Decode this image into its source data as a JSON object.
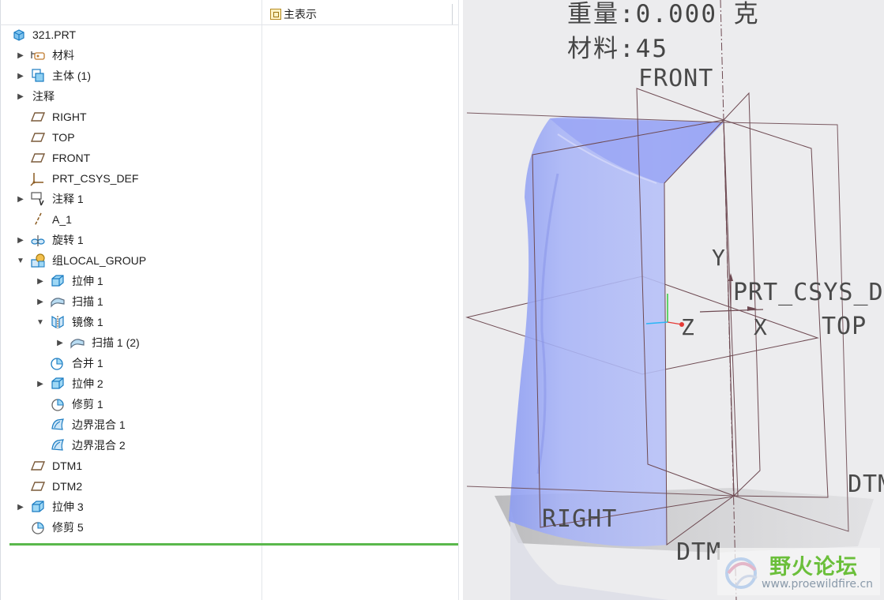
{
  "tree": {
    "column_header": "主表示",
    "root": "321.PRT",
    "items": [
      {
        "label": "材料",
        "icon": "material-icon",
        "expander": "collapsed"
      },
      {
        "label": "主体 (1)",
        "icon": "body-icon",
        "expander": "collapsed"
      },
      {
        "label": "注释",
        "icon": "",
        "expander": "collapsed"
      },
      {
        "label": "RIGHT",
        "icon": "datum-plane-icon",
        "expander": "none"
      },
      {
        "label": "TOP",
        "icon": "datum-plane-icon",
        "expander": "none"
      },
      {
        "label": "FRONT",
        "icon": "datum-plane-icon",
        "expander": "none"
      },
      {
        "label": "PRT_CSYS_DEF",
        "icon": "csys-icon",
        "expander": "none"
      },
      {
        "label": "注释 1",
        "icon": "annotation-icon",
        "expander": "collapsed"
      },
      {
        "label": "A_1",
        "icon": "datum-axis-icon",
        "expander": "none"
      },
      {
        "label": "旋转 1",
        "icon": "revolve-icon",
        "expander": "collapsed"
      },
      {
        "label": "组LOCAL_GROUP",
        "icon": "group-icon",
        "expander": "expanded"
      },
      {
        "label": "拉伸 1",
        "icon": "extrude-icon",
        "expander": "collapsed"
      },
      {
        "label": "扫描 1",
        "icon": "sweep-icon",
        "expander": "collapsed"
      },
      {
        "label": "镜像 1",
        "icon": "mirror-icon",
        "expander": "expanded"
      },
      {
        "label": "扫描 1 (2)",
        "icon": "sweep-icon",
        "expander": "collapsed"
      },
      {
        "label": "合并 1",
        "icon": "merge-icon",
        "expander": "none"
      },
      {
        "label": "拉伸 2",
        "icon": "extrude-icon",
        "expander": "collapsed"
      },
      {
        "label": "修剪 1",
        "icon": "trim-icon",
        "expander": "none"
      },
      {
        "label": "边界混合 1",
        "icon": "boundary-blend-icon",
        "expander": "none"
      },
      {
        "label": "边界混合 2",
        "icon": "boundary-blend-icon",
        "expander": "none"
      },
      {
        "label": "DTM1",
        "icon": "datum-plane-icon",
        "expander": "none"
      },
      {
        "label": "DTM2",
        "icon": "datum-plane-icon",
        "expander": "none"
      },
      {
        "label": "拉伸 3",
        "icon": "extrude-icon",
        "expander": "collapsed"
      },
      {
        "label": "修剪 5",
        "icon": "trim-icon",
        "expander": "none"
      }
    ]
  },
  "viewport": {
    "note_weight": "重量:0.000 克",
    "note_material": "材料:45",
    "datum_front": "FRONT",
    "datum_top": "TOP",
    "datum_right": "RIGHT",
    "datum_dtm_bottom": "DTM",
    "datum_dtm_right": "DTM",
    "csys_label": "PRT_CSYS_D",
    "axis_y": "Y",
    "axis_x": "X",
    "axis_z": "Z",
    "watermark_title": "野火论坛",
    "watermark_url": "www.proewildfire.cn",
    "colors": {
      "part_fill": "#a6b2f5",
      "datum_line": "#6e4a52",
      "background": "#ececee",
      "watermark_green": "#6bbf3b"
    }
  }
}
